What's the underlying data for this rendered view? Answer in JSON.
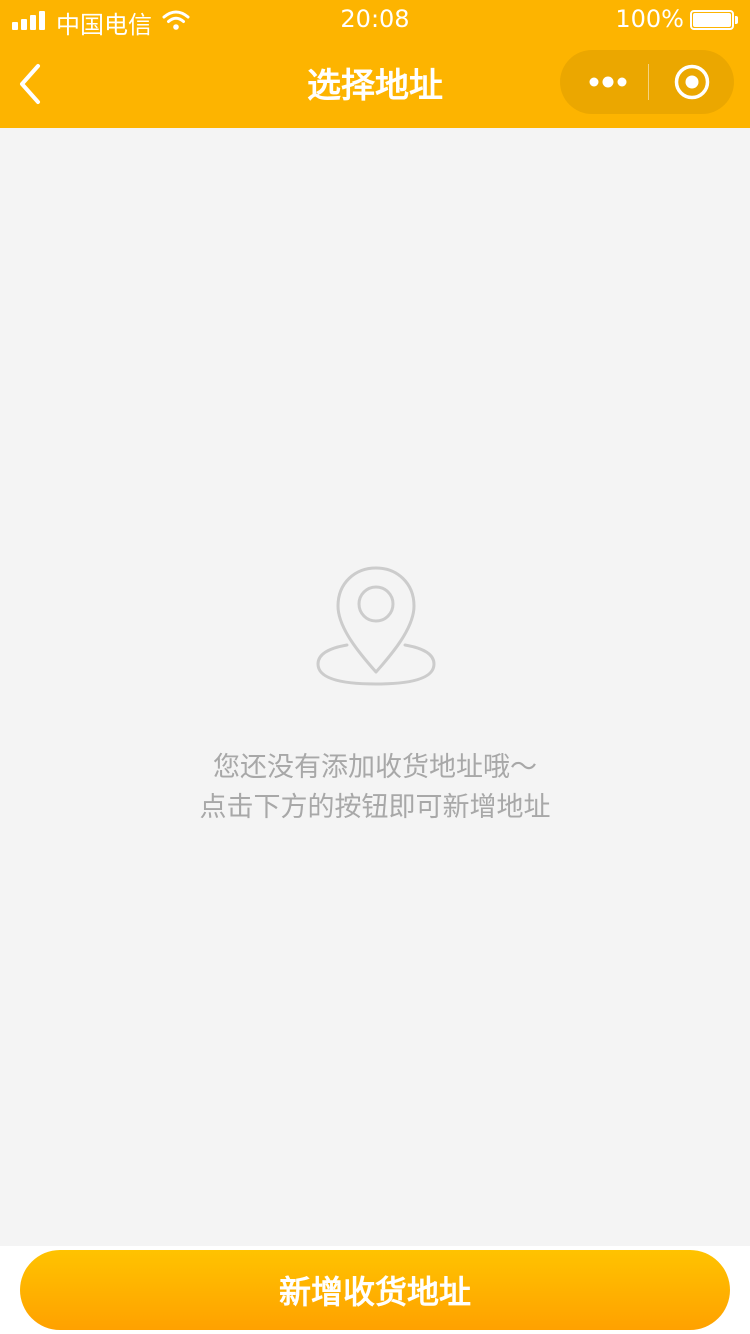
{
  "status_bar": {
    "carrier": "中国电信",
    "time": "20:08",
    "battery_percent": "100%",
    "battery_level": 1.0,
    "signal_bars": 4
  },
  "nav": {
    "title": "选择地址",
    "back_icon": "chevron-left-icon",
    "more_icon": "more-dots-icon",
    "close_icon": "target-circle-icon"
  },
  "empty_state": {
    "icon": "location-pin-icon",
    "line1": "您还没有添加收货地址哦～",
    "line2": "点击下方的按钮即可新增地址"
  },
  "footer": {
    "add_button_label": "新增收货地址"
  },
  "colors": {
    "brand": "#fdb400",
    "button_gradient_top": "#ffc300",
    "button_gradient_bottom": "#ffa100",
    "background": "#f4f4f4",
    "muted_text": "#a8a8a8"
  }
}
